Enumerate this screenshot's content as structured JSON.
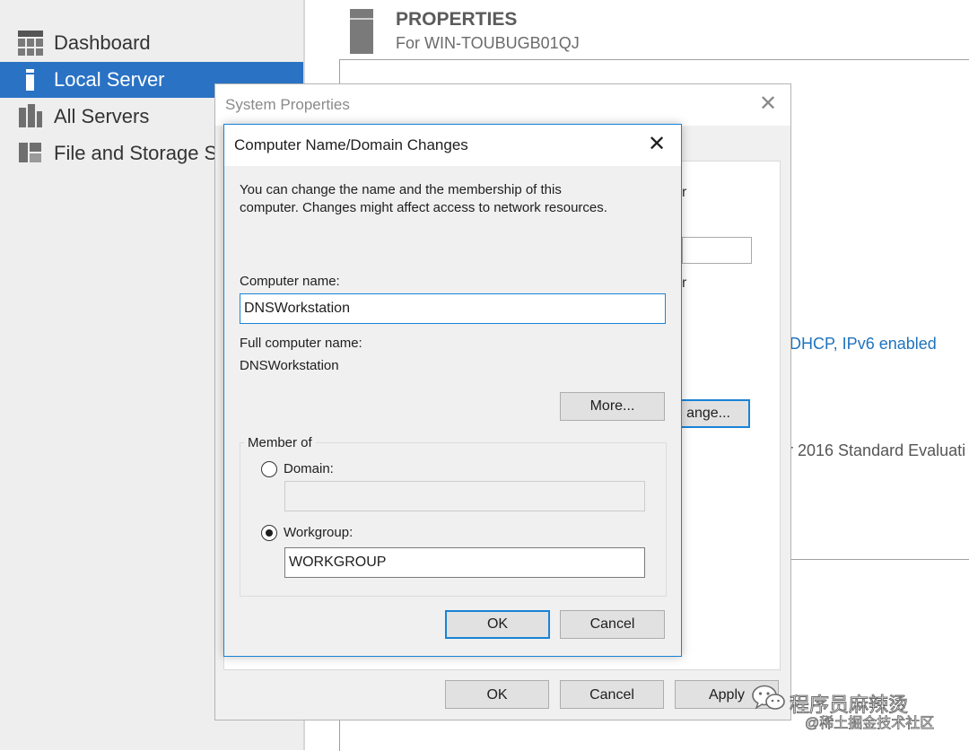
{
  "sidebar": {
    "items": [
      {
        "label": "Dashboard",
        "icon": "dashboard-icon",
        "active": false
      },
      {
        "label": "Local Server",
        "icon": "local-server-icon",
        "active": true
      },
      {
        "label": "All Servers",
        "icon": "all-servers-icon",
        "active": false
      },
      {
        "label": "File and Storage Se",
        "icon": "file-storage-icon",
        "active": false
      }
    ]
  },
  "properties": {
    "title": "PROPERTIES",
    "subtitle": "For WIN-TOUBUGB01QJ",
    "network_link": "DHCP, IPv6 enabled",
    "os_text": "r 2016 Standard Evaluati"
  },
  "system_properties": {
    "title": "System Properties",
    "fragment_1": "r",
    "fragment_2": "r",
    "change_button": "ange...",
    "ok_label": "OK",
    "cancel_label": "Cancel",
    "apply_label": "Apply"
  },
  "dialog": {
    "title": "Computer Name/Domain Changes",
    "description_line1": "You can change the name and the membership of this",
    "description_line2": "computer. Changes might affect access to network resources.",
    "computer_name_label": "Computer name:",
    "computer_name_value": "DNSWorkstation",
    "full_name_label": "Full computer name:",
    "full_name_value": "DNSWorkstation",
    "more_label": "More...",
    "member_of_label": "Member of",
    "domain_label": "Domain:",
    "domain_value": "",
    "domain_selected": false,
    "workgroup_label": "Workgroup:",
    "workgroup_value": "WORKGROUP",
    "workgroup_selected": true,
    "ok_label": "OK",
    "cancel_label": "Cancel"
  },
  "watermark": {
    "line1": "程序员麻辣烫",
    "line2": "@稀土掘金技术社区"
  },
  "colors": {
    "accent": "#2a72c4",
    "dialog_border": "#1883d7",
    "link": "#1e73be"
  }
}
